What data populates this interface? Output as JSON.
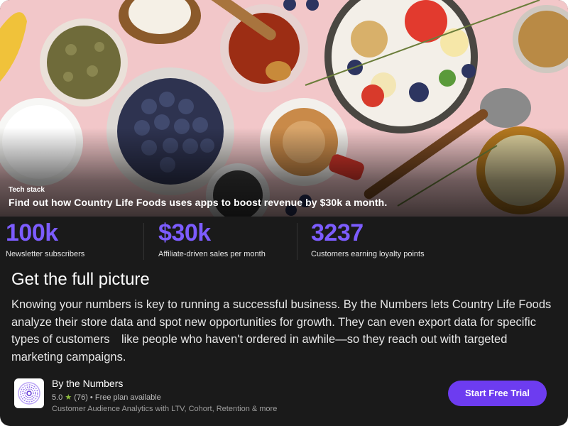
{
  "hero": {
    "eyebrow": "Tech stack",
    "title": "Find out how Country Life Foods uses apps to boost revenue by $30k a month."
  },
  "stats": [
    {
      "value": "100k",
      "label": "Newsletter subscribers"
    },
    {
      "value": "$30k",
      "label": "Affiliate-driven sales per month"
    },
    {
      "value": "3237",
      "label": "Customers earning loyalty points"
    }
  ],
  "section": {
    "title": "Get the full picture",
    "body": "Knowing your numbers is key to running a successful business. By the Numbers lets Country Life Foods analyze their store data and spot new opportunities for growth. They can even export data for specific types of customers like people who haven't ordered in awhile—so they reach out with targeted marketing campaigns."
  },
  "app": {
    "name": "By the Numbers",
    "rating": "5.0",
    "star_icon": "star-icon",
    "reviews": "(76)",
    "separator": "•",
    "plan": "Free plan available",
    "description": "Customer Audience Analytics with LTV, Cohort, Retention & more",
    "icon": "by-the-numbers-logo-icon"
  },
  "cta": {
    "label": "Start Free Trial"
  },
  "colors": {
    "accent": "#7c5cff",
    "button": "#6d3cf0",
    "card_background": "#1a1a1a",
    "hero_background": "#f2c7c9",
    "star": "#8fbf3c"
  }
}
